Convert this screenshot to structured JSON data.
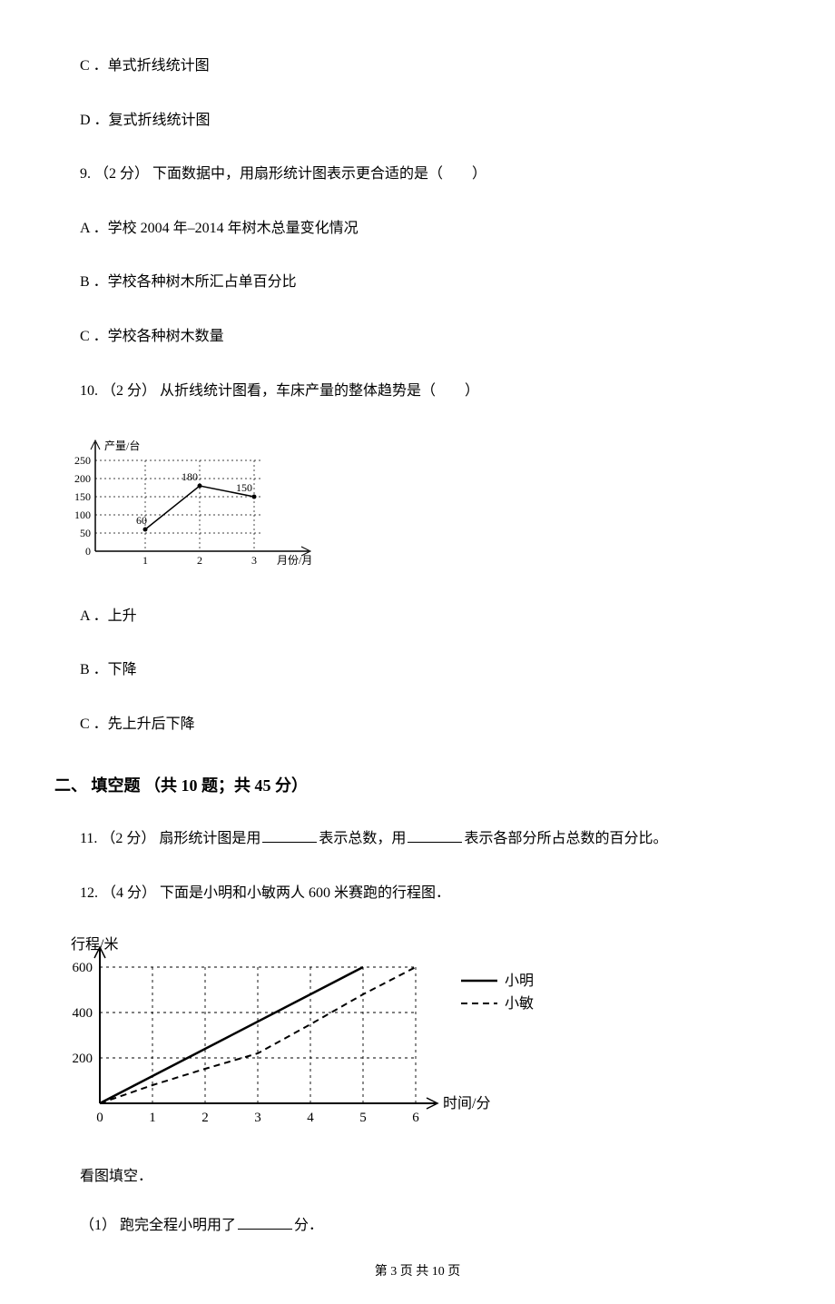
{
  "options_top": {
    "c": "C ．单式折线统计图",
    "d": "D ．复式折线统计图"
  },
  "q9": {
    "stem": "9. （2 分） 下面数据中，用扇形统计图表示更合适的是（　　）",
    "a": "A ．学校 2004 年–2014 年树木总量变化情况",
    "b": "B ．学校各种树木所汇占单百分比",
    "c": "C ．学校各种树木数量"
  },
  "q10": {
    "stem": "10. （2 分） 从折线统计图看，车床产量的整体趋势是（　　）",
    "a": "A ．上升",
    "b": "B ．下降",
    "c": "C ．先上升后下降"
  },
  "section2_title": "二、 填空题 （共 10 题；共 45 分）",
  "q11": {
    "prefix": "11. （2 分） 扇形统计图是用",
    "mid": "表示总数，用",
    "suffix": "表示各部分所占总数的百分比。"
  },
  "q12": {
    "stem": "12. （4 分） 下面是小明和小敏两人 600 米赛跑的行程图．",
    "look": "看图填空．",
    "sub1_prefix": "（1） 跑完全程小明用了",
    "sub1_suffix": "分．"
  },
  "footer": "第 3 页 共 10 页",
  "chart_data": [
    {
      "type": "line",
      "title": "",
      "xlabel": "月份/月",
      "ylabel": "产量/台",
      "x": [
        1,
        2,
        3
      ],
      "values": [
        60,
        180,
        150
      ],
      "y_ticks": [
        0,
        50,
        100,
        150,
        200,
        250
      ],
      "x_ticks": [
        1,
        2,
        3
      ],
      "data_labels": [
        "60",
        "180",
        "150"
      ]
    },
    {
      "type": "line",
      "title": "",
      "xlabel": "时间/分",
      "ylabel": "行程/米",
      "x_ticks": [
        0,
        1,
        2,
        3,
        4,
        5,
        6
      ],
      "y_ticks": [
        0,
        200,
        400,
        600
      ],
      "series": [
        {
          "name": "小明",
          "style": "solid",
          "x": [
            0,
            1,
            2,
            3,
            4,
            5
          ],
          "y": [
            0,
            120,
            240,
            360,
            480,
            600
          ]
        },
        {
          "name": "小敏",
          "style": "dashed",
          "x": [
            0,
            1,
            2,
            3,
            4,
            5,
            6
          ],
          "y": [
            0,
            80,
            150,
            220,
            350,
            480,
            600
          ]
        }
      ],
      "legend": [
        "小明",
        "小敏"
      ]
    }
  ]
}
